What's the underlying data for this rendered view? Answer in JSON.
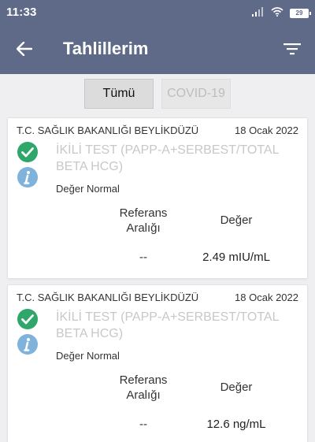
{
  "status_bar": {
    "time": "11:33",
    "battery": "29"
  },
  "header": {
    "title": "Tahlillerim"
  },
  "tabs": [
    {
      "label": "Tümü",
      "selected": true
    },
    {
      "label": "COVID-19",
      "selected": false
    }
  ],
  "results": [
    {
      "institution": "T.C. SAĞLIK BAKANLIĞI BEYLİKDÜZÜ",
      "date": "18 Ocak 2022",
      "test_name": "İKİLİ TEST (PAPP-A+SERBEST/TOTAL BETA HCG)",
      "status": "Değer Normal",
      "reference_label": "Referans Aralığı",
      "value_label": "Değer",
      "reference": "--",
      "value": "2.49 mIU/mL"
    },
    {
      "institution": "T.C. SAĞLIK BAKANLIĞI BEYLİKDÜZÜ",
      "date": "18 Ocak 2022",
      "test_name": "İKİLİ TEST (PAPP-A+SERBEST/TOTAL BETA HCG)",
      "status": "Değer Normal",
      "reference_label": "Referans Aralığı",
      "value_label": "Değer",
      "reference": "--",
      "value": "12.6 ng/mL"
    }
  ],
  "colors": {
    "app_bar": "#5f6a88",
    "check": "#2fa66a",
    "info": "#7fb3dc"
  }
}
